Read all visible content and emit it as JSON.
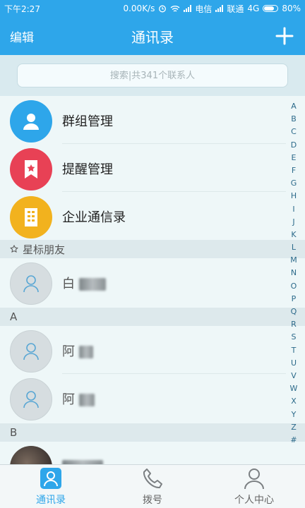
{
  "status_bar": {
    "time": "下午2:27",
    "speed": "0.00K/s",
    "carrier1": "电信",
    "carrier2": "联通",
    "network": "4G",
    "battery": "80%"
  },
  "nav": {
    "edit_label": "编辑",
    "title": "通讯录"
  },
  "search": {
    "placeholder": "搜索|共341个联系人"
  },
  "groups": [
    {
      "label": "群组管理",
      "color": "#2ea6ea",
      "icon": "person-icon"
    },
    {
      "label": "提醒管理",
      "color": "#e84155",
      "icon": "bookmark-star-icon"
    },
    {
      "label": "企业通信录",
      "color": "#f2b21e",
      "icon": "building-icon"
    }
  ],
  "sections": {
    "starred": "星标朋友",
    "a": "A",
    "b": "B"
  },
  "contacts": [
    {
      "name": "白"
    },
    {
      "name": "阿"
    },
    {
      "name": "阿"
    }
  ],
  "index_letters": [
    "A",
    "B",
    "C",
    "D",
    "E",
    "F",
    "G",
    "H",
    "I",
    "J",
    "K",
    "L",
    "M",
    "N",
    "O",
    "P",
    "Q",
    "R",
    "S",
    "T",
    "U",
    "V",
    "W",
    "X",
    "Y",
    "Z",
    "#"
  ],
  "tabs": [
    {
      "label": "通讯录",
      "icon": "contacts-icon",
      "active": true
    },
    {
      "label": "拨号",
      "icon": "phone-icon",
      "active": false
    },
    {
      "label": "个人中心",
      "icon": "person-center-icon",
      "active": false
    }
  ],
  "colors": {
    "primary": "#2ea6ea",
    "group_blue": "#2ea6ea",
    "group_red": "#e84155",
    "group_yellow": "#f2b21e"
  }
}
